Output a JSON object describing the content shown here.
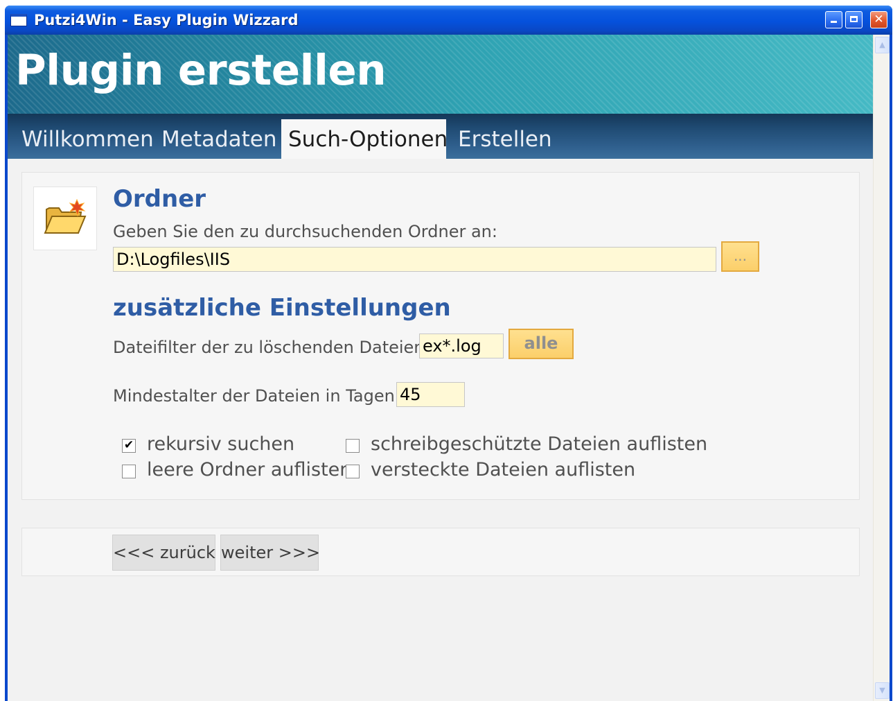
{
  "window": {
    "title": "Putzi4Win - Easy Plugin Wizzard",
    "controls": [
      "minimize-icon",
      "maximize-icon",
      "close-icon"
    ]
  },
  "header": {
    "title": "Plugin erstellen"
  },
  "tabs": [
    {
      "label": "Willkommen",
      "active": false
    },
    {
      "label": "Metadaten",
      "active": false
    },
    {
      "label": "Such-Optionen",
      "active": true
    },
    {
      "label": "Erstellen",
      "active": false
    }
  ],
  "folder_section": {
    "icon": "folder-icon",
    "title": "Ordner",
    "prompt": "Geben Sie den zu durchsuchenden Ordner an:",
    "path_value": "D:\\Logfiles\\IIS",
    "browse_label": "..."
  },
  "extra_section": {
    "title": "zusätzliche Einstellungen",
    "filter_label": "Dateifilter der zu löschenden Dateien:",
    "filter_value": "ex*.log",
    "all_button_label": "alle",
    "min_age_label": "Mindestalter der Dateien in Tagen:",
    "min_age_value": "45"
  },
  "options": [
    {
      "label": "rekursiv suchen",
      "checked": true
    },
    {
      "label": "schreibgeschützte Dateien auflisten",
      "checked": false
    },
    {
      "label": "leere Ordner auflisten",
      "checked": false
    },
    {
      "label": "versteckte Dateien auflisten",
      "checked": false
    }
  ],
  "navigation": {
    "back_label": "<<< zurück",
    "next_label": "weiter >>>"
  },
  "colors": {
    "titlebar": "#0551dc",
    "accent_title": "#2f5da5",
    "input_background": "#fff9d6",
    "button_yellow": "#fbcf6a"
  }
}
